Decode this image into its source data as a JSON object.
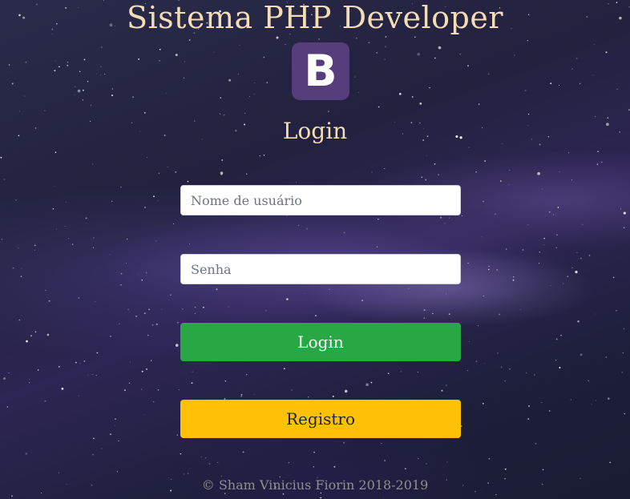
{
  "header": {
    "title": "Sistema PHP Developer",
    "logo_letter": "B",
    "logo_color": "#563d7c"
  },
  "login_form": {
    "heading": "Login",
    "username_placeholder": "Nome de usuário",
    "username_value": "",
    "password_placeholder": "Senha",
    "password_value": "",
    "login_button_label": "Login",
    "register_button_label": "Registro"
  },
  "footer": {
    "copyright": "© Sham Vinicius Fiorin 2018-2019"
  },
  "colors": {
    "title_text": "#f4dcb4",
    "login_button": "#28a745",
    "register_button": "#ffc107",
    "footer_text": "#8f8f8f"
  }
}
